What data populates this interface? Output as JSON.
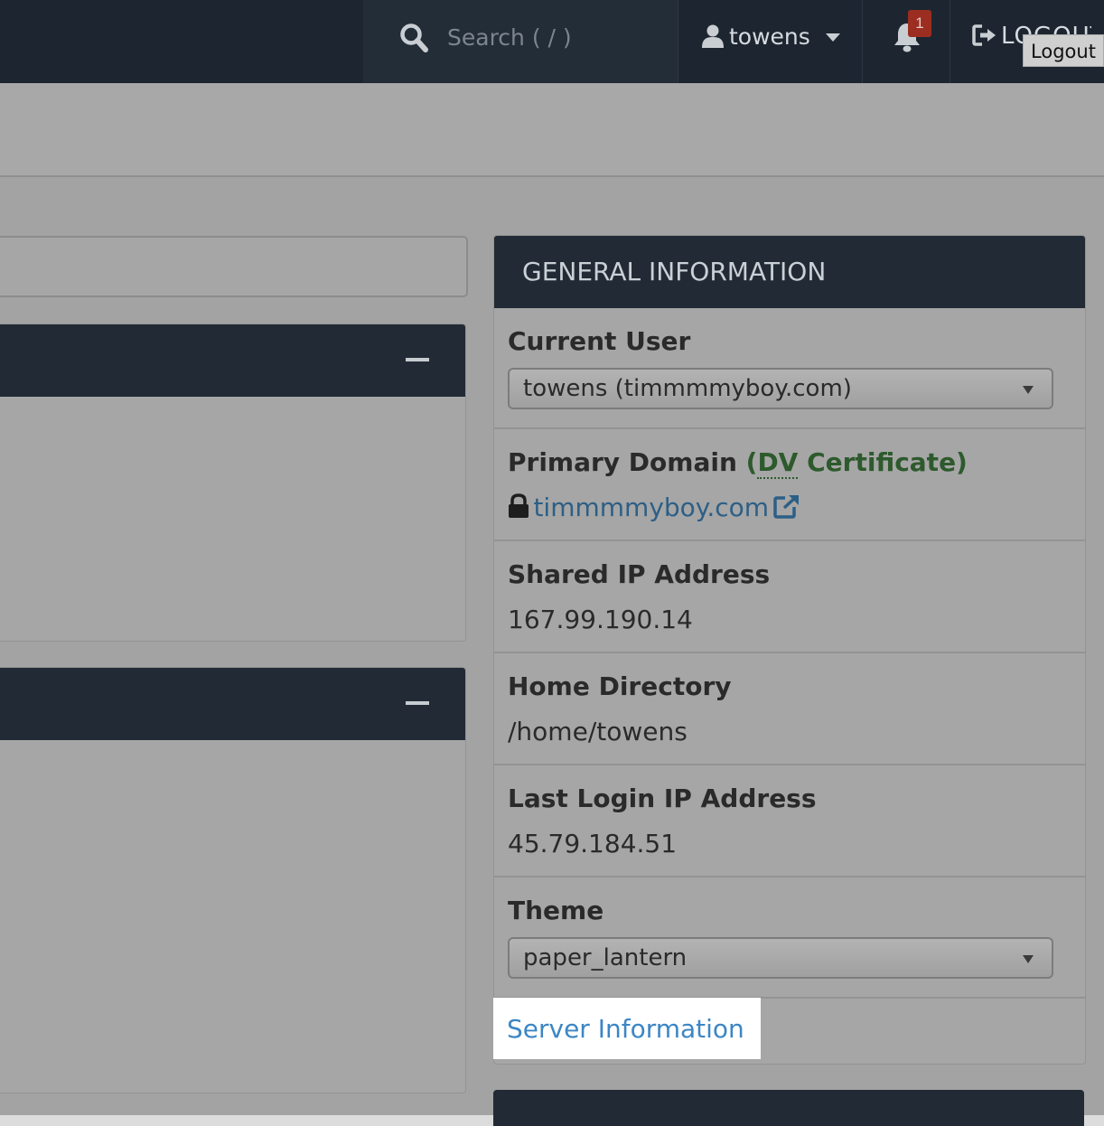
{
  "topbar": {
    "search_placeholder": "Search ( / )",
    "username": "towens",
    "notification_count": "1",
    "logout_label": "LOGOUT",
    "logout_tooltip": "Logout"
  },
  "general_info": {
    "title": "GENERAL INFORMATION",
    "current_user_label": "Current User",
    "current_user_value": "towens (timmmmyboy.com)",
    "primary_domain_label": "Primary Domain",
    "cert_open": "(",
    "cert_abbr": "DV",
    "cert_rest": " Certificate)",
    "primary_domain_value": "timmmmyboy.com",
    "shared_ip_label": "Shared IP Address",
    "shared_ip_value": "167.99.190.14",
    "home_dir_label": "Home Directory",
    "home_dir_value": "/home/towens",
    "last_login_label": "Last Login IP Address",
    "last_login_value": "45.79.184.51",
    "theme_label": "Theme",
    "theme_value": "paper_lantern",
    "server_info_link": "Server Information"
  },
  "icons": [
    "search-icon",
    "user-icon",
    "chevron-down-icon",
    "bell-icon",
    "logout-icon",
    "minus-icon",
    "lock-icon",
    "external-link-icon"
  ]
}
